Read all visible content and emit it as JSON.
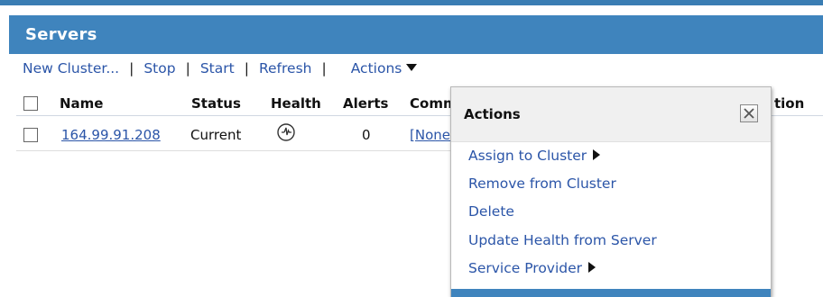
{
  "panel": {
    "title": "Servers"
  },
  "toolbar": {
    "new_cluster": "New Cluster...",
    "stop": "Stop",
    "start": "Start",
    "refresh": "Refresh",
    "actions": "Actions",
    "separator": "|"
  },
  "table": {
    "columns": [
      "Name",
      "Status",
      "Health",
      "Alerts",
      "Comm",
      "tion"
    ],
    "rows": [
      {
        "name": "164.99.91.208",
        "status": "Current",
        "health_icon": "health-status-icon",
        "alerts": "0",
        "comm": "[None"
      }
    ]
  },
  "actions_popup": {
    "title": "Actions",
    "close_icon": "close-icon",
    "items": [
      {
        "label": "Assign to Cluster",
        "has_submenu": true
      },
      {
        "label": "Remove from Cluster",
        "has_submenu": false
      },
      {
        "label": "Delete",
        "has_submenu": false
      },
      {
        "label": "Update Health from Server",
        "has_submenu": false
      },
      {
        "label": "Service Provider",
        "has_submenu": true
      }
    ]
  },
  "colors": {
    "header_blue": "#3f84bd",
    "link_blue": "#2b55a8",
    "popup_header_bg": "#f0f0f0"
  }
}
